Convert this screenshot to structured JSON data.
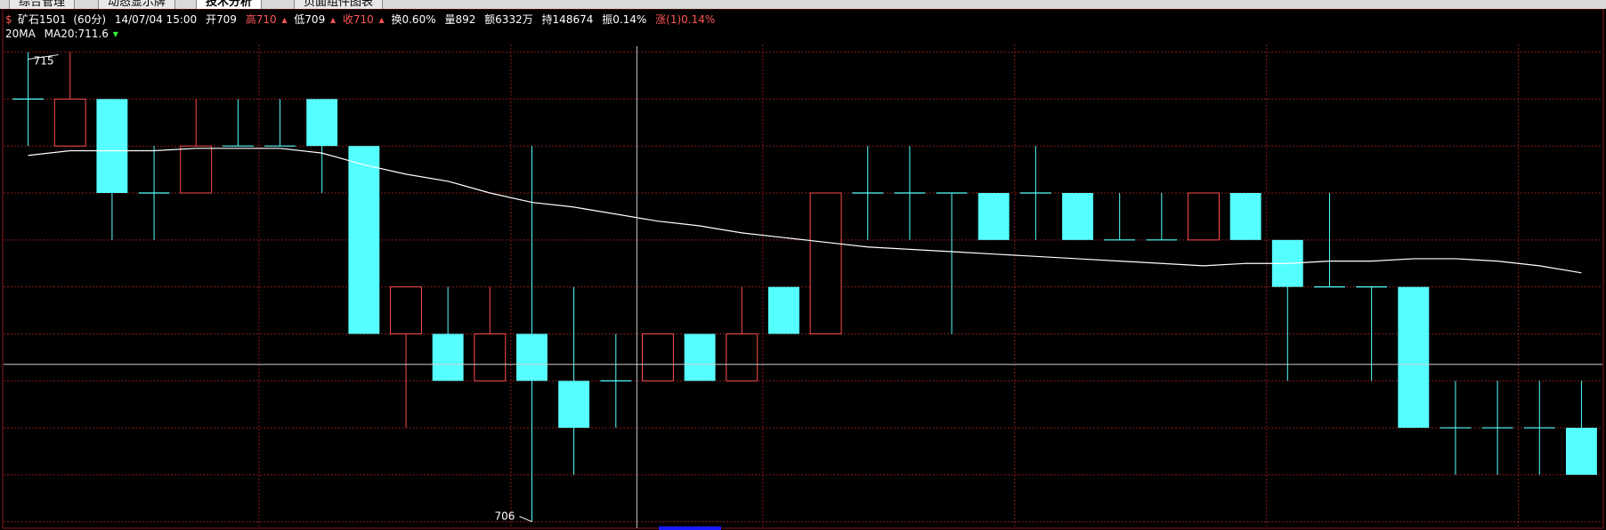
{
  "tabs": [
    {
      "label": "综合管理"
    },
    {
      "label": "动态显示牌"
    },
    {
      "label": "技术分析",
      "active": true
    },
    {
      "label": "页面组件图表"
    }
  ],
  "header": {
    "contract": "矿石1501",
    "period": "(60分)",
    "datetime": "14/07/04 15:00",
    "open": "开709",
    "high": "高710",
    "low": "低709",
    "close": "收710",
    "turnover": "换0.60%",
    "volume": "量892",
    "amount": "额6332万",
    "openint": "持148674",
    "amplitude": "振0.14%",
    "change": "涨(1)0.14%"
  },
  "ma_label": {
    "name": "20MA",
    "value": "MA20:711.6"
  },
  "colors": {
    "up": "#ff4d4d",
    "down": "#55ffff",
    "ma": "#ffffff",
    "grid": "#8a1a1a",
    "text": "#ffffff",
    "red_text": "#ff5555"
  },
  "chart_data": {
    "type": "candlestick",
    "title": "矿石1501 (60分)",
    "ylim": [
      705.9,
      716.2
    ],
    "grid": true,
    "candles": [
      {
        "o": 715,
        "h": 716,
        "l": 714,
        "c": 715
      },
      {
        "o": 714,
        "h": 716,
        "l": 714,
        "c": 715
      },
      {
        "o": 715,
        "h": 715,
        "l": 712,
        "c": 713
      },
      {
        "o": 713,
        "h": 714,
        "l": 712,
        "c": 713
      },
      {
        "o": 713,
        "h": 715,
        "l": 713,
        "c": 714
      },
      {
        "o": 714,
        "h": 715,
        "l": 714,
        "c": 714
      },
      {
        "o": 714,
        "h": 715,
        "l": 714,
        "c": 714
      },
      {
        "o": 715,
        "h": 715,
        "l": 713,
        "c": 714
      },
      {
        "o": 714,
        "h": 714,
        "l": 710,
        "c": 710
      },
      {
        "o": 710,
        "h": 711,
        "l": 708,
        "c": 711
      },
      {
        "o": 710,
        "h": 711,
        "l": 709,
        "c": 709
      },
      {
        "o": 709,
        "h": 711,
        "l": 709,
        "c": 710
      },
      {
        "o": 710,
        "h": 714,
        "l": 706,
        "c": 709
      },
      {
        "o": 709,
        "h": 711,
        "l": 707,
        "c": 708
      },
      {
        "o": 709,
        "h": 710,
        "l": 708,
        "c": 709
      },
      {
        "o": 709,
        "h": 710,
        "l": 709,
        "c": 710
      },
      {
        "o": 710,
        "h": 710,
        "l": 709,
        "c": 709
      },
      {
        "o": 709,
        "h": 711,
        "l": 709,
        "c": 710
      },
      {
        "o": 711,
        "h": 711,
        "l": 710,
        "c": 710
      },
      {
        "o": 710,
        "h": 713,
        "l": 710,
        "c": 713
      },
      {
        "o": 713,
        "h": 714,
        "l": 712,
        "c": 713
      },
      {
        "o": 713,
        "h": 714,
        "l": 712,
        "c": 713
      },
      {
        "o": 713,
        "h": 713,
        "l": 710,
        "c": 713
      },
      {
        "o": 713,
        "h": 713,
        "l": 712,
        "c": 712
      },
      {
        "o": 713,
        "h": 714,
        "l": 712,
        "c": 713
      },
      {
        "o": 713,
        "h": 713,
        "l": 712,
        "c": 712
      },
      {
        "o": 712,
        "h": 713,
        "l": 712,
        "c": 712
      },
      {
        "o": 712,
        "h": 713,
        "l": 712,
        "c": 712
      },
      {
        "o": 712,
        "h": 713,
        "l": 712,
        "c": 713
      },
      {
        "o": 713,
        "h": 713,
        "l": 712,
        "c": 712
      },
      {
        "o": 712,
        "h": 712,
        "l": 709,
        "c": 711
      },
      {
        "o": 711,
        "h": 713,
        "l": 711,
        "c": 711
      },
      {
        "o": 711,
        "h": 711,
        "l": 709,
        "c": 711
      },
      {
        "o": 711,
        "h": 711,
        "l": 708,
        "c": 708
      },
      {
        "o": 708,
        "h": 709,
        "l": 707,
        "c": 708
      },
      {
        "o": 708,
        "h": 709,
        "l": 707,
        "c": 708
      },
      {
        "o": 708,
        "h": 709,
        "l": 707,
        "c": 708
      },
      {
        "o": 708,
        "h": 709,
        "l": 707,
        "c": 707
      }
    ],
    "ma20": [
      713.8,
      713.9,
      713.9,
      713.9,
      713.95,
      713.95,
      713.95,
      713.85,
      713.6,
      713.4,
      713.25,
      713.0,
      712.8,
      712.7,
      712.55,
      712.4,
      712.3,
      712.15,
      712.05,
      711.95,
      711.85,
      711.8,
      711.75,
      711.7,
      711.65,
      711.6,
      711.55,
      711.5,
      711.45,
      711.5,
      711.5,
      711.55,
      711.55,
      711.6,
      711.6,
      711.55,
      711.45,
      711.3
    ],
    "annotations": [
      {
        "label": "715",
        "candle": 0,
        "value": 716
      },
      {
        "label": "706",
        "candle": 12,
        "value": 706
      }
    ],
    "crosshair": {
      "candle": 15,
      "value": 709.35
    }
  }
}
